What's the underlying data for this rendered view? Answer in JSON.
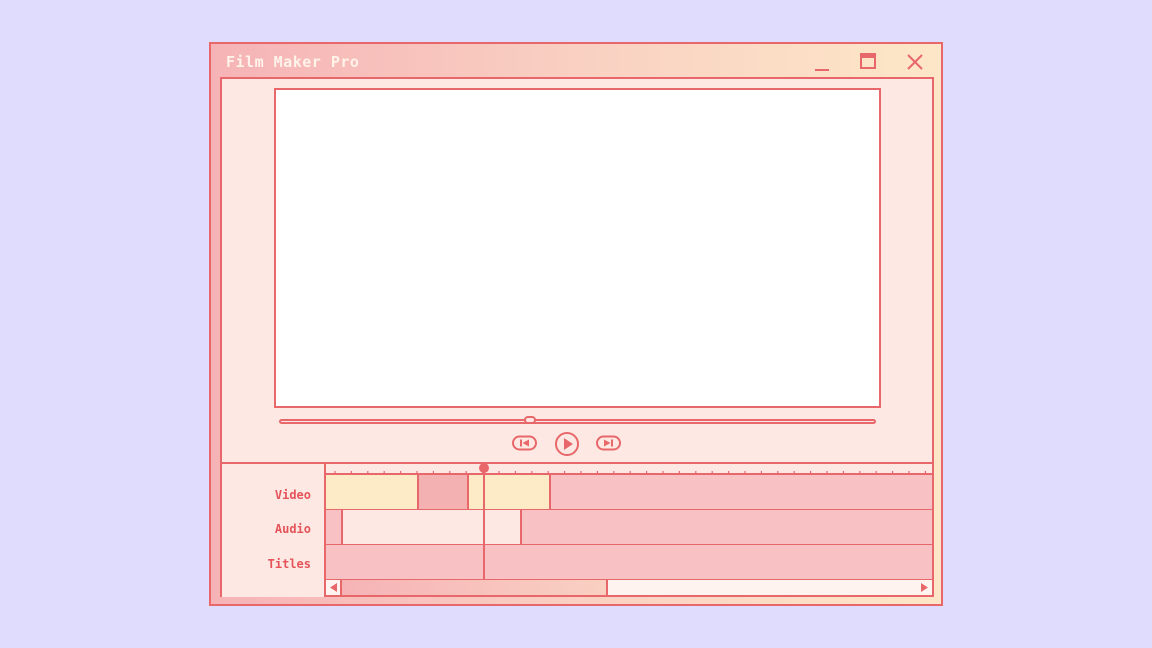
{
  "window": {
    "title": "Film Maker Pro"
  },
  "controls": {
    "minimize": "minimize-icon",
    "maximize": "maximize-icon",
    "close": "close-icon"
  },
  "playback": {
    "position_fraction": 0.42,
    "buttons": [
      {
        "name": "skip-back",
        "icon": "skip-back-icon"
      },
      {
        "name": "play",
        "icon": "play-icon"
      },
      {
        "name": "skip-forward",
        "icon": "skip-forward-icon"
      }
    ]
  },
  "timeline": {
    "tracks": [
      {
        "label": "Video"
      },
      {
        "label": "Audio"
      },
      {
        "label": "Titles"
      }
    ]
  },
  "colors": {
    "accent": "#e8676a",
    "background": "#dfdcfe",
    "panel": "#fee8e3",
    "clip_yellow": "#fdebc7",
    "clip_pink": "#f8c1c3",
    "clip_dark": "#f3b1b1"
  }
}
